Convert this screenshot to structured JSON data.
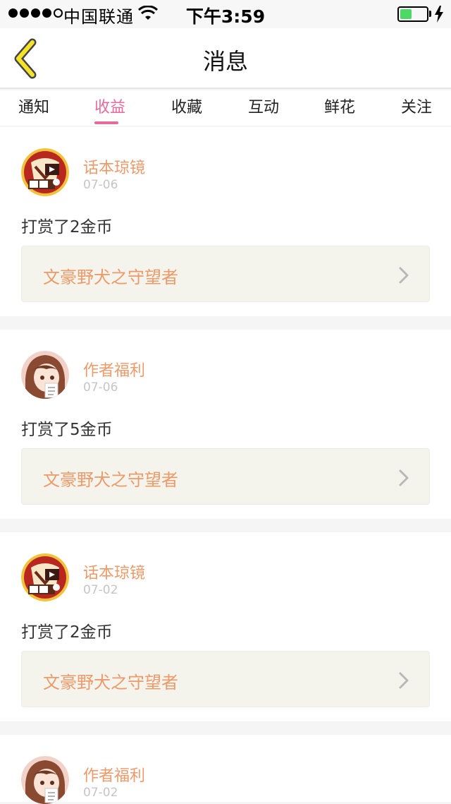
{
  "status_bar": {
    "carrier": "中国联通",
    "time": "下午3:59",
    "battery_level": 0.45
  },
  "nav": {
    "title": "消息",
    "back_icon": "back-chevron-icon"
  },
  "tabs": [
    {
      "label": "通知",
      "active": false
    },
    {
      "label": "收益",
      "active": true
    },
    {
      "label": "收藏",
      "active": false
    },
    {
      "label": "互动",
      "active": false
    },
    {
      "label": "鲜花",
      "active": false
    },
    {
      "label": "关注",
      "active": false
    }
  ],
  "messages": [
    {
      "sender": "话本琼镜",
      "date": "07-06",
      "text": "打赏了2金币",
      "link_title": "文豪野犬之守望者",
      "avatar": "avatar-huaben"
    },
    {
      "sender": "作者福利",
      "date": "07-06",
      "text": "打赏了5金币",
      "link_title": "文豪野犬之守望者",
      "avatar": "avatar-zuozhe"
    },
    {
      "sender": "话本琼镜",
      "date": "07-02",
      "text": "打赏了2金币",
      "link_title": "文豪野犬之守望者",
      "avatar": "avatar-huaben"
    },
    {
      "sender": "作者福利",
      "date": "07-02",
      "text": "",
      "link_title": "",
      "avatar": "avatar-zuozhe"
    }
  ],
  "colors": {
    "accent": "#e66a9b",
    "sender": "#ec9a6a",
    "back_icon": "#f5e32a"
  }
}
